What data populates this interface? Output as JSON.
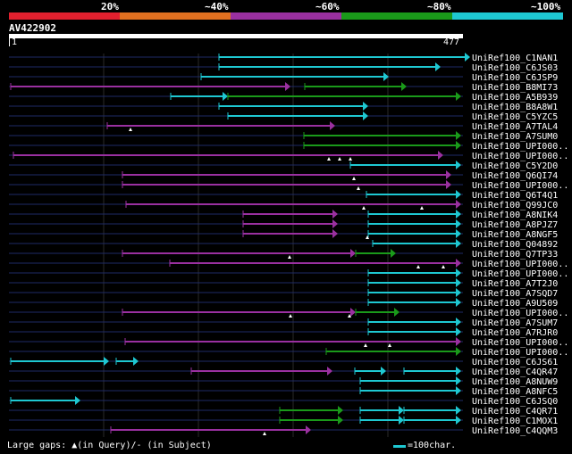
{
  "legend": {
    "labels": [
      "20%",
      "~40%",
      "~60%",
      "~80%",
      "~100%"
    ],
    "colors": [
      "#e0202e",
      "#e07020",
      "#9a30a0",
      "#1a9a1a",
      "#1ec8d2"
    ]
  },
  "query": {
    "name": "AV422902",
    "start": "1",
    "end": "477"
  },
  "footer": {
    "gaps_text": "Large gaps: ▲(in Query)/- (in Subject)",
    "scale_text": "=100char."
  },
  "hits": [
    {
      "label": "UniRef100_C1NAN1",
      "segs": [
        [
          245,
          526,
          "cyan"
        ]
      ],
      "marks": []
    },
    {
      "label": "UniRef100_C6JS03",
      "segs": [
        [
          245,
          493,
          "cyan"
        ]
      ],
      "marks": []
    },
    {
      "label": "UniRef100_C6JSP9",
      "segs": [
        [
          225,
          435,
          "cyan"
        ]
      ],
      "marks": []
    },
    {
      "label": "UniRef100_B8MI73",
      "segs": [
        [
          12,
          325,
          "purple"
        ],
        [
          341,
          455,
          "green"
        ]
      ],
      "marks": []
    },
    {
      "label": "UniRef100_A5B939",
      "segs": [
        [
          191,
          255,
          "cyan"
        ],
        [
          255,
          516,
          "green"
        ]
      ],
      "marks": []
    },
    {
      "label": "UniRef100_B8A8W1",
      "segs": [
        [
          245,
          412,
          "cyan"
        ]
      ],
      "marks": []
    },
    {
      "label": "UniRef100_C5YZC5",
      "segs": [
        [
          255,
          412,
          "cyan"
        ]
      ],
      "marks": []
    },
    {
      "label": "UniRef100_A7TAL4",
      "segs": [
        [
          120,
          375,
          "purple"
        ]
      ],
      "marks": [
        146
      ]
    },
    {
      "label": "UniRef100_A7SUM0",
      "segs": [
        [
          340,
          516,
          "green"
        ]
      ],
      "marks": []
    },
    {
      "label": "UniRef100_UPI000..",
      "segs": [
        [
          340,
          516,
          "green"
        ]
      ],
      "marks": []
    },
    {
      "label": "UniRef100_UPI000..",
      "segs": [
        [
          15,
          496,
          "purple"
        ]
      ],
      "marks": [
        368,
        380,
        392
      ]
    },
    {
      "label": "UniRef100_C5Y2D0",
      "segs": [
        [
          392,
          516,
          "cyan"
        ]
      ],
      "marks": []
    },
    {
      "label": "UniRef100_Q6QI74",
      "segs": [
        [
          137,
          505,
          "purple"
        ]
      ],
      "marks": [
        396
      ]
    },
    {
      "label": "UniRef100_UPI000..",
      "segs": [
        [
          137,
          505,
          "purple"
        ]
      ],
      "marks": [
        401
      ]
    },
    {
      "label": "UniRef100_Q6T4Q1",
      "segs": [
        [
          410,
          516,
          "cyan"
        ]
      ],
      "marks": []
    },
    {
      "label": "UniRef100_Q99JC0",
      "segs": [
        [
          141,
          516,
          "purple"
        ]
      ],
      "marks": [
        407,
        472
      ]
    },
    {
      "label": "UniRef100_A8NIK4",
      "segs": [
        [
          272,
          378,
          "purple"
        ],
        [
          412,
          516,
          "cyan"
        ]
      ],
      "marks": []
    },
    {
      "label": "UniRef100_A8PJZ7",
      "segs": [
        [
          272,
          378,
          "purple"
        ],
        [
          412,
          516,
          "cyan"
        ]
      ],
      "marks": []
    },
    {
      "label": "UniRef100_A8NGF5",
      "segs": [
        [
          272,
          378,
          "purple"
        ],
        [
          412,
          516,
          "cyan"
        ]
      ],
      "marks": [
        411
      ]
    },
    {
      "label": "UniRef100_Q04892",
      "segs": [
        [
          417,
          516,
          "cyan"
        ]
      ],
      "marks": []
    },
    {
      "label": "UniRef100_Q7TP33",
      "segs": [
        [
          137,
          398,
          "purple"
        ],
        [
          398,
          443,
          "green"
        ]
      ],
      "marks": [
        324
      ]
    },
    {
      "label": "UniRef100_UPI000..",
      "segs": [
        [
          190,
          516,
          "purple"
        ]
      ],
      "marks": [
        468,
        496
      ]
    },
    {
      "label": "UniRef100_UPI000..",
      "segs": [
        [
          412,
          516,
          "cyan"
        ]
      ],
      "marks": []
    },
    {
      "label": "UniRef100_A7T2J0",
      "segs": [
        [
          412,
          516,
          "cyan"
        ]
      ],
      "marks": []
    },
    {
      "label": "UniRef100_A7SQD7",
      "segs": [
        [
          412,
          516,
          "cyan"
        ]
      ],
      "marks": []
    },
    {
      "label": "UniRef100_A9U509",
      "segs": [
        [
          412,
          516,
          "cyan"
        ]
      ],
      "marks": []
    },
    {
      "label": "UniRef100_UPI000..",
      "segs": [
        [
          137,
          398,
          "purple"
        ],
        [
          398,
          447,
          "green"
        ]
      ],
      "marks": [
        325,
        391
      ]
    },
    {
      "label": "UniRef100_A7SUM7",
      "segs": [
        [
          412,
          516,
          "cyan"
        ]
      ],
      "marks": []
    },
    {
      "label": "UniRef100_A7RJR0",
      "segs": [
        [
          412,
          516,
          "cyan"
        ]
      ],
      "marks": []
    },
    {
      "label": "UniRef100_UPI000..",
      "segs": [
        [
          140,
          516,
          "purple"
        ]
      ],
      "marks": [
        409,
        436
      ]
    },
    {
      "label": "UniRef100_UPI000..",
      "segs": [
        [
          365,
          516,
          "green"
        ]
      ],
      "marks": []
    },
    {
      "label": "UniRef100_C6JS61",
      "segs": [
        [
          12,
          122,
          "cyan"
        ],
        [
          130,
          155,
          "cyan"
        ]
      ],
      "marks": []
    },
    {
      "label": "UniRef100_C4QR47",
      "segs": [
        [
          214,
          372,
          "purple"
        ],
        [
          397,
          432,
          "cyan"
        ],
        [
          452,
          516,
          "cyan"
        ]
      ],
      "marks": []
    },
    {
      "label": "UniRef100_A8NUW9",
      "segs": [
        [
          403,
          516,
          "cyan"
        ]
      ],
      "marks": []
    },
    {
      "label": "UniRef100_A8NFC5",
      "segs": [
        [
          403,
          516,
          "cyan"
        ]
      ],
      "marks": []
    },
    {
      "label": "UniRef100_C6JSQ0",
      "segs": [
        [
          12,
          90,
          "cyan"
        ]
      ],
      "marks": []
    },
    {
      "label": "UniRef100_C4QR71",
      "segs": [
        [
          313,
          384,
          "green"
        ],
        [
          403,
          452,
          "cyan"
        ],
        [
          452,
          516,
          "cyan"
        ]
      ],
      "marks": []
    },
    {
      "label": "UniRef100_C1MOX1",
      "segs": [
        [
          313,
          384,
          "green"
        ],
        [
          403,
          452,
          "cyan"
        ],
        [
          452,
          516,
          "cyan"
        ]
      ],
      "marks": []
    },
    {
      "label": "UniRef100_C4QQM3",
      "segs": [
        [
          124,
          348,
          "purple"
        ]
      ],
      "marks": [
        296
      ]
    }
  ]
}
